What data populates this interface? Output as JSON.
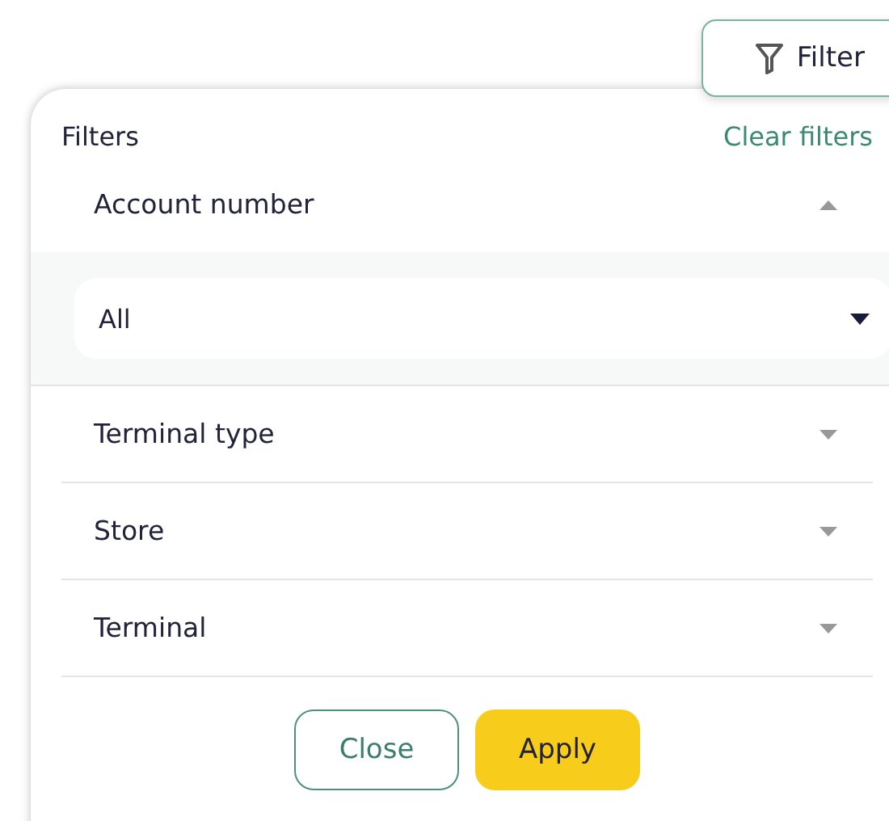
{
  "filter_button": {
    "label": "Filter"
  },
  "panel": {
    "title": "Filters",
    "clear_link": "Clear filters",
    "sections": [
      {
        "label": "Account number",
        "expanded": true,
        "select": {
          "value": "All"
        }
      },
      {
        "label": "Terminal type",
        "expanded": false
      },
      {
        "label": "Store",
        "expanded": false
      },
      {
        "label": "Terminal",
        "expanded": false
      }
    ],
    "buttons": [
      {
        "label": "Close",
        "kind": "secondary"
      },
      {
        "label": "Apply",
        "kind": "primary"
      }
    ]
  }
}
